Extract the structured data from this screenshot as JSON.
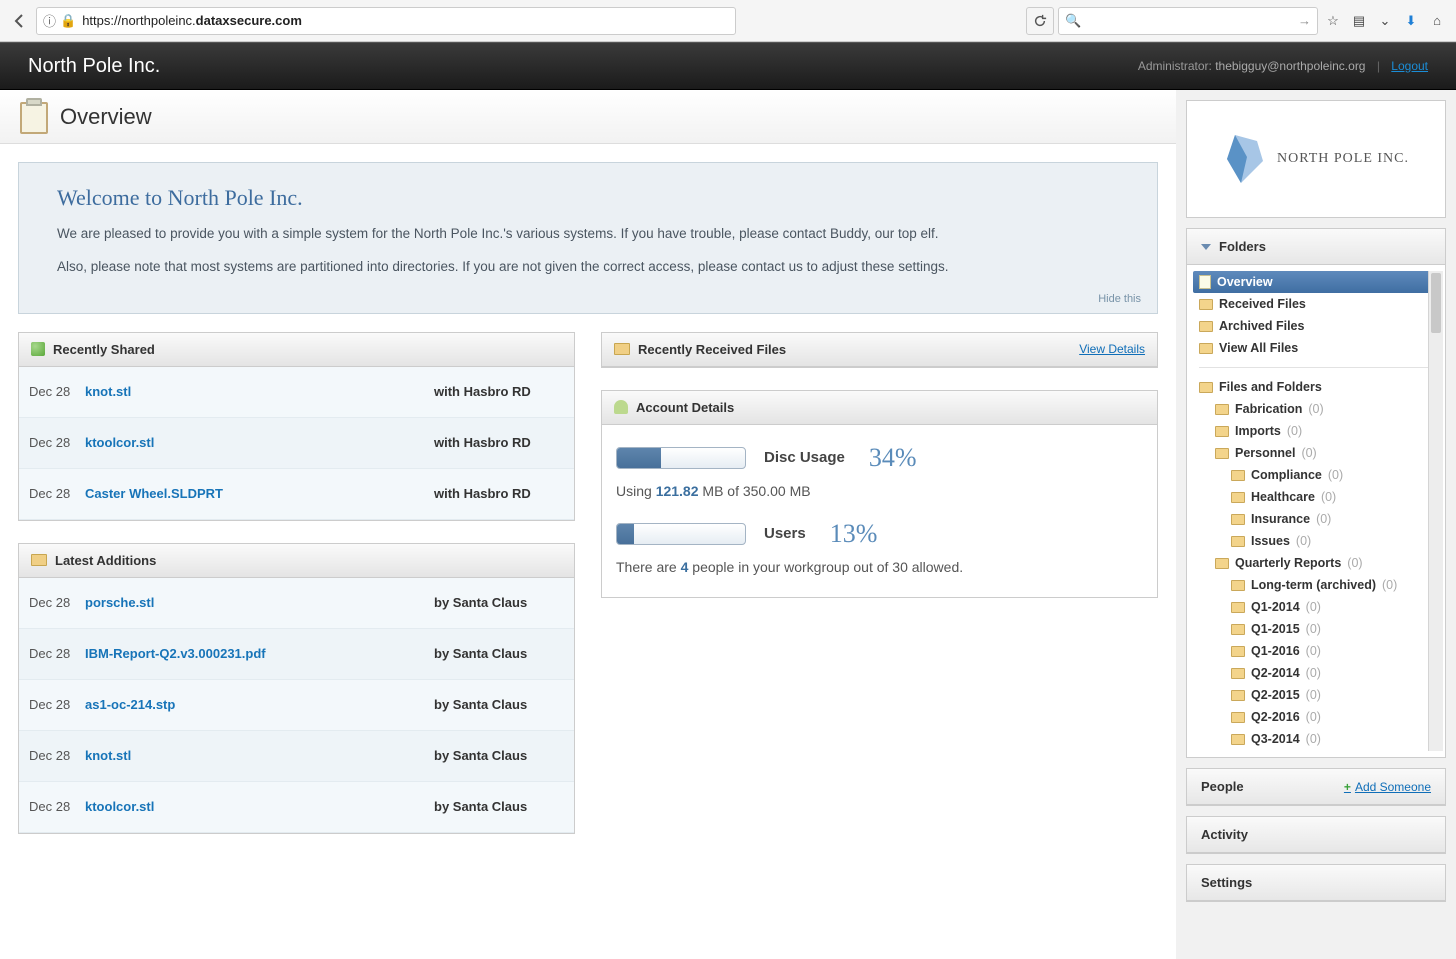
{
  "browser": {
    "url_prefix": "https://northpoleinc.",
    "url_host": "dataxsecure.com",
    "search_placeholder": ""
  },
  "header": {
    "brand": "North Pole Inc.",
    "admin_prefix": "Administrator: ",
    "admin_email": "thebigguy@northpoleinc.org",
    "logout": "Logout"
  },
  "page_title": "Overview",
  "welcome": {
    "title": "Welcome to North Pole Inc.",
    "p1": "We are pleased to provide you with a simple system for the North Pole Inc.'s various systems. If you have trouble, please contact Buddy, our top elf.",
    "p2": "Also, please note that most systems are partitioned into directories. If you are not given the correct access, please contact us to adjust these settings.",
    "hide": "Hide this"
  },
  "recently_shared": {
    "title": "Recently Shared",
    "rows": [
      {
        "date": "Dec 28",
        "file": "knot.stl",
        "meta": "with Hasbro RD"
      },
      {
        "date": "Dec 28",
        "file": "ktoolcor.stl",
        "meta": "with Hasbro RD"
      },
      {
        "date": "Dec 28",
        "file": "Caster Wheel.SLDPRT",
        "meta": "with Hasbro RD"
      }
    ]
  },
  "latest_additions": {
    "title": "Latest Additions",
    "rows": [
      {
        "date": "Dec 28",
        "file": "porsche.stl",
        "meta": "by Santa Claus"
      },
      {
        "date": "Dec 28",
        "file": "IBM-Report-Q2.v3.000231.pdf",
        "meta": "by Santa Claus"
      },
      {
        "date": "Dec 28",
        "file": "as1-oc-214.stp",
        "meta": "by Santa Claus"
      },
      {
        "date": "Dec 28",
        "file": "knot.stl",
        "meta": "by Santa Claus"
      },
      {
        "date": "Dec 28",
        "file": "ktoolcor.stl",
        "meta": "by Santa Claus"
      }
    ]
  },
  "recently_received": {
    "title": "Recently Received Files",
    "view_details": "View Details"
  },
  "account": {
    "title": "Account Details",
    "disc_label": "Disc Usage",
    "disc_pct": "34%",
    "disc_line_pre": "Using ",
    "disc_used": "121.82",
    "disc_line_post": " MB of 350.00 MB",
    "users_label": "Users",
    "users_pct": "13%",
    "users_line_pre": "There are ",
    "users_count": "4",
    "users_line_post": " people in your workgroup out of 30 allowed."
  },
  "sidebar": {
    "logo_text": "NORTH POLE INC.",
    "folders_title": "Folders",
    "people_title": "People",
    "add_someone": "Add Someone",
    "activity_title": "Activity",
    "settings_title": "Settings",
    "tree_top": [
      {
        "label": "Overview",
        "icon": "clipboard",
        "selected": true
      },
      {
        "label": "Received Files",
        "icon": "inbox"
      },
      {
        "label": "Archived Files",
        "icon": "inbox"
      },
      {
        "label": "View All Files",
        "icon": "inbox"
      }
    ],
    "tree_root_label": "Files and Folders",
    "tree": [
      {
        "label": "Fabrication",
        "count": "(0)",
        "indent": 1
      },
      {
        "label": "Imports",
        "count": "(0)",
        "indent": 1
      },
      {
        "label": "Personnel",
        "count": "(0)",
        "indent": 1
      },
      {
        "label": "Compliance",
        "count": "(0)",
        "indent": 2
      },
      {
        "label": "Healthcare",
        "count": "(0)",
        "indent": 2
      },
      {
        "label": "Insurance",
        "count": "(0)",
        "indent": 2
      },
      {
        "label": "Issues",
        "count": "(0)",
        "indent": 2
      },
      {
        "label": "Quarterly Reports",
        "count": "(0)",
        "indent": 1
      },
      {
        "label": "Long-term (archived)",
        "count": "(0)",
        "indent": 2
      },
      {
        "label": "Q1-2014",
        "count": "(0)",
        "indent": 2
      },
      {
        "label": "Q1-2015",
        "count": "(0)",
        "indent": 2
      },
      {
        "label": "Q1-2016",
        "count": "(0)",
        "indent": 2
      },
      {
        "label": "Q2-2014",
        "count": "(0)",
        "indent": 2
      },
      {
        "label": "Q2-2015",
        "count": "(0)",
        "indent": 2
      },
      {
        "label": "Q2-2016",
        "count": "(0)",
        "indent": 2
      },
      {
        "label": "Q3-2014",
        "count": "(0)",
        "indent": 2
      }
    ]
  }
}
